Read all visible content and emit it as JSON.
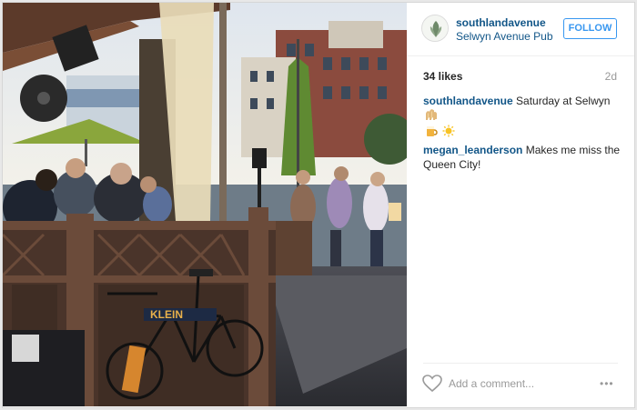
{
  "post": {
    "image": {
      "description_icon": "patio-photo",
      "bike_brand_text": "KLEIN"
    },
    "header": {
      "username": "southlandavenue",
      "location": "Selwyn Avenue Pub",
      "follow_label": "FOLLOW"
    },
    "stats": {
      "likes": "34 likes",
      "age": "2d"
    },
    "comments": [
      {
        "user": "southlandavenue",
        "text": "Saturday at Selwyn"
      },
      {
        "user": "megan_leanderson",
        "text": "Makes me miss the Queen City!"
      }
    ],
    "footer": {
      "comment_placeholder": "Add a comment...",
      "more_label": "•••"
    }
  },
  "colors": {
    "link": "#125688",
    "follow_blue": "#3897f0",
    "muted": "#999999"
  }
}
